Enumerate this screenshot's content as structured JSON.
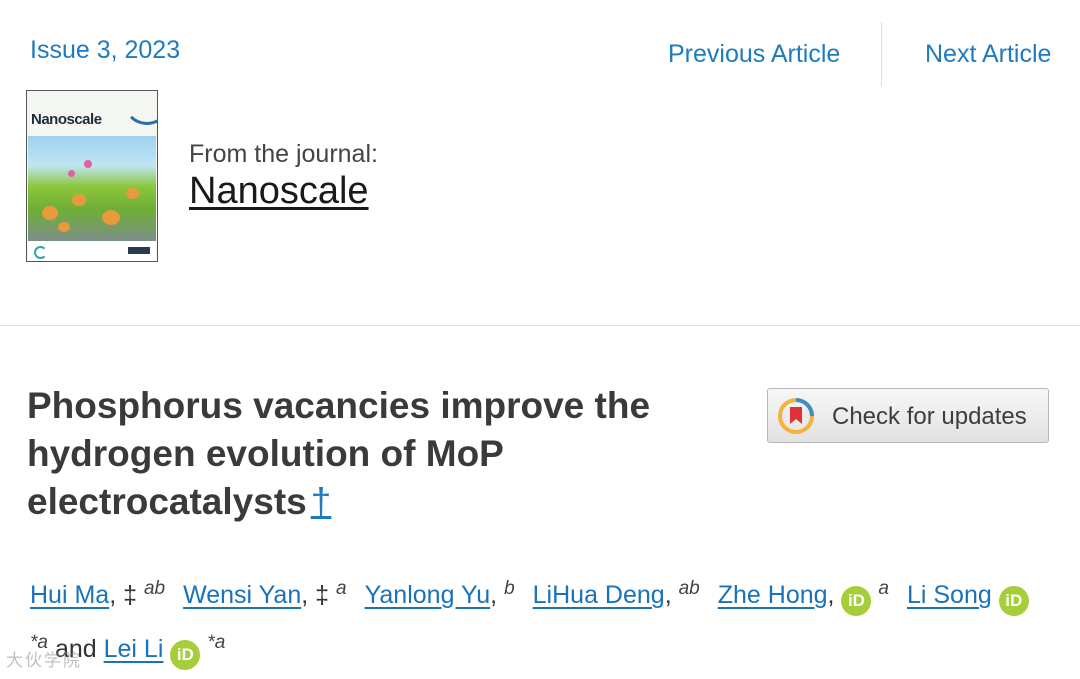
{
  "header": {
    "issue_link": "Issue 3, 2023",
    "previous_label": "Previous Article",
    "next_label": "Next Article"
  },
  "journal": {
    "cover_title": "Nanoscale",
    "from_label": "From the journal:",
    "name": "Nanoscale"
  },
  "article": {
    "title_lines": [
      "Phosphorus vacancies improve the",
      "hydrogen evolution of MoP",
      "electrocatalysts"
    ],
    "title_footnote": "†",
    "check_updates_label": "Check for updates"
  },
  "authors": [
    {
      "name": "Hui Ma",
      "marks": "‡",
      "affil": "ab",
      "orcid": false
    },
    {
      "name": "Wensi Yan",
      "marks": "‡",
      "affil": "a",
      "orcid": false
    },
    {
      "name": "Yanlong Yu",
      "marks": "",
      "affil": "b",
      "orcid": false
    },
    {
      "name": "LiHua Deng",
      "marks": "",
      "affil": "ab",
      "orcid": false
    },
    {
      "name": "Zhe Hong",
      "marks": "",
      "affil": "a",
      "orcid": true
    },
    {
      "name": "Li Song",
      "marks": "*",
      "affil": "a",
      "orcid": true
    },
    {
      "name": "Lei Li",
      "marks": "*",
      "affil": "a",
      "orcid": true
    }
  ],
  "authors_joiner": "and",
  "orcid_label": "iD",
  "watermark": "大伙学院",
  "colors": {
    "link": "#1f7bbf",
    "orcid": "#a6ce39",
    "title": "#3a3a3a"
  }
}
